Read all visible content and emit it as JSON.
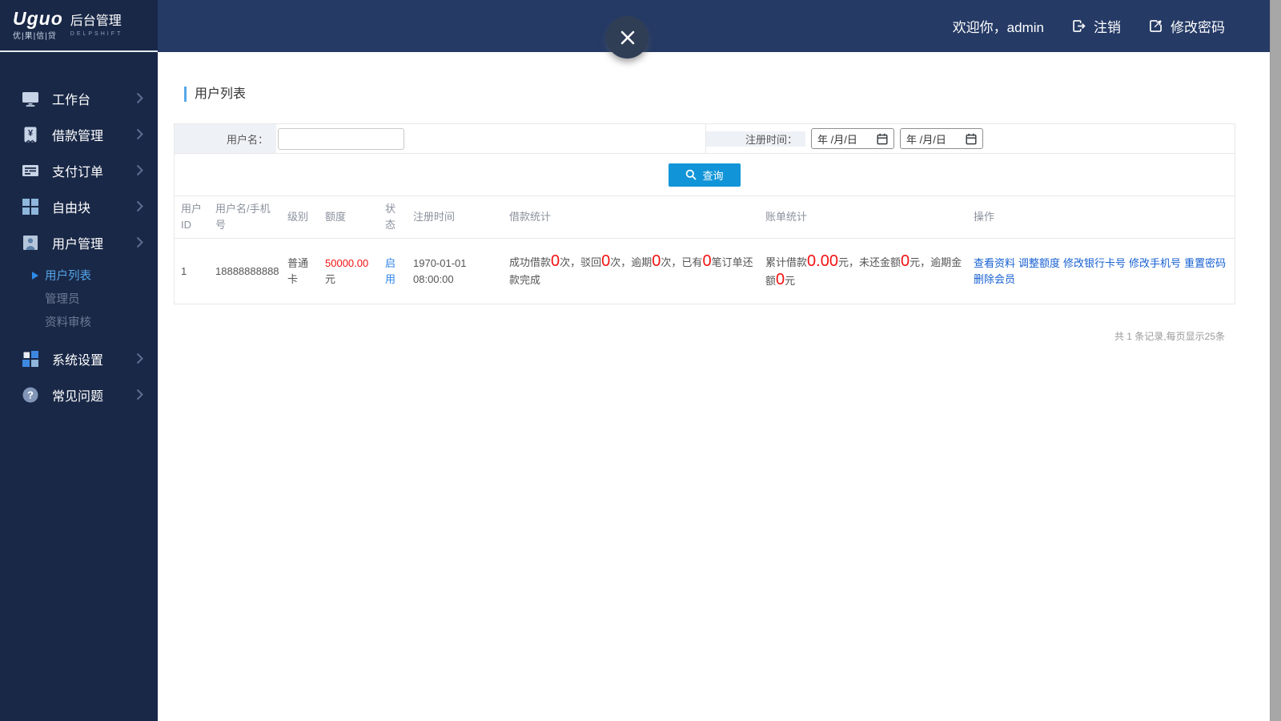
{
  "logo": {
    "brand": "Uguo",
    "brand_sub": "优|果|信|贷",
    "title": "后台管理",
    "subtitle": "DELPSHIFT"
  },
  "header": {
    "welcome": "欢迎你，admin",
    "logout": "注销",
    "change_password": "修改密码"
  },
  "sidebar": {
    "items": [
      {
        "label": "工作台"
      },
      {
        "label": "借款管理"
      },
      {
        "label": "支付订单"
      },
      {
        "label": "自由块"
      },
      {
        "label": "用户管理"
      },
      {
        "label": "系统设置"
      },
      {
        "label": "常见问题"
      }
    ],
    "submenu": [
      {
        "label": "用户列表"
      },
      {
        "label": "管理员"
      },
      {
        "label": "资料审核"
      }
    ]
  },
  "page": {
    "title": "用户列表"
  },
  "filter": {
    "username_label": "用户名：",
    "regtime_label": "注册时间：",
    "date_value": "年 /月/日",
    "search_button": "查询"
  },
  "table": {
    "headers": [
      "用户ID",
      "用户名/手机号",
      "级别",
      "额度",
      "状态",
      "注册时间",
      "借款统计",
      "账单统计",
      "操作"
    ],
    "row": {
      "user_id": "1",
      "username": "18888888888",
      "level": "普通卡",
      "quota_amount": "50000.00",
      "quota_unit": " 元",
      "status": "启用",
      "reg_time": "1970-01-01 08:00:00",
      "loan_stats": [
        {
          "t": "成功借款"
        },
        {
          "n": "0"
        },
        {
          "t": "次，驳回"
        },
        {
          "n": "0"
        },
        {
          "t": "次，逾期"
        },
        {
          "n": "0"
        },
        {
          "t": "次，已有"
        },
        {
          "n": "0"
        },
        {
          "t": "笔订单还款完成"
        }
      ],
      "bill_stats": [
        {
          "t": "累计借款"
        },
        {
          "n": "0.00"
        },
        {
          "t": "元，未还金额"
        },
        {
          "n": "0"
        },
        {
          "t": "元，逾期金额"
        },
        {
          "n": "0"
        },
        {
          "t": "元"
        }
      ],
      "actions": [
        "查看资料",
        "调整额度",
        "修改银行卡号",
        "修改手机号",
        "重置密码",
        "删除会员"
      ]
    }
  },
  "footer": {
    "summary": "共 1 条记录,每页显示25条"
  },
  "colors": {
    "header_bg": "#253a65",
    "sidebar_bg": "#192847",
    "accent": "#1295d8",
    "link_blue": "#1660d2",
    "active_menu": "#55a7ea",
    "red": "#f21212",
    "status_blue": "#2d84e8"
  }
}
